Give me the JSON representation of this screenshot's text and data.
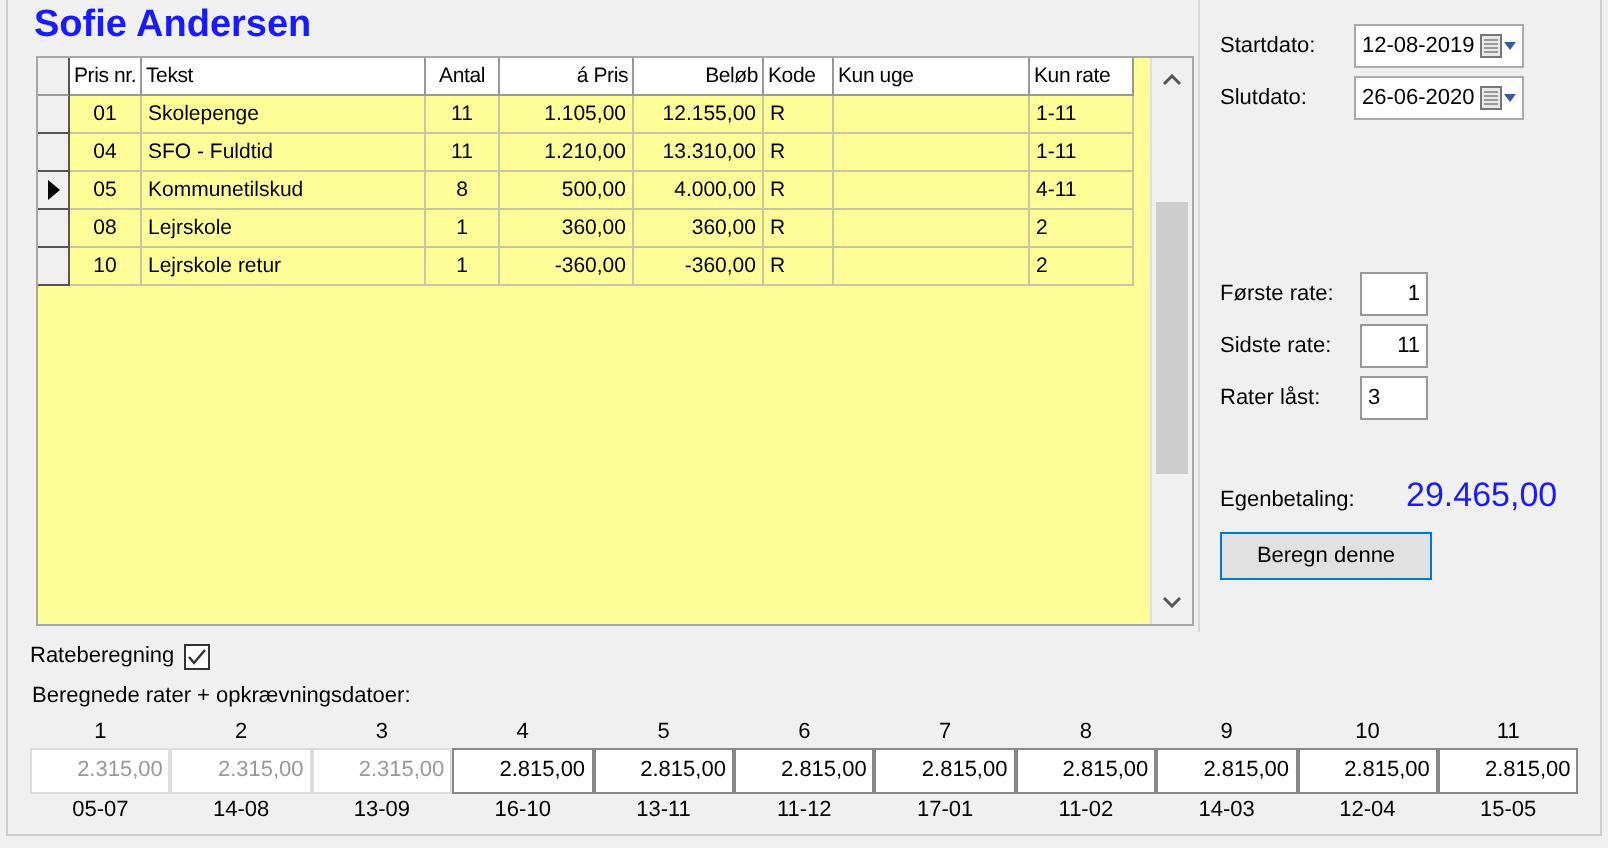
{
  "title": "Sofie Andersen",
  "table": {
    "columns": [
      "Pris nr.",
      "Tekst",
      "Antal",
      "á Pris",
      "Beløb",
      "Kode",
      "Kun uge",
      "Kun rate"
    ],
    "rows": [
      {
        "selected": false,
        "cells": [
          "01",
          "Skolepenge",
          "11",
          "1.105,00",
          "12.155,00",
          "R",
          "",
          "1-11"
        ]
      },
      {
        "selected": false,
        "cells": [
          "04",
          "SFO - Fuldtid",
          "11",
          "1.210,00",
          "13.310,00",
          "R",
          "",
          "1-11"
        ]
      },
      {
        "selected": true,
        "cells": [
          "05",
          "Kommunetilskud",
          "8",
          "500,00",
          "4.000,00",
          "R",
          "",
          "4-11"
        ]
      },
      {
        "selected": false,
        "cells": [
          "08",
          "Lejrskole",
          "1",
          "360,00",
          "360,00",
          "R",
          "",
          "2"
        ]
      },
      {
        "selected": false,
        "cells": [
          "10",
          "Lejrskole retur",
          "1",
          "-360,00",
          "-360,00",
          "R",
          "",
          "2"
        ]
      }
    ]
  },
  "dates": [
    {
      "label": "Startdato:",
      "value": "12-08-2019"
    },
    {
      "label": "Slutdato:",
      "value": "26-06-2020"
    }
  ],
  "rate_fields": [
    {
      "label": "Første rate:",
      "value": "1",
      "kind": "rate"
    },
    {
      "label": "Sidste rate:",
      "value": "11",
      "kind": "rate"
    },
    {
      "label": "Rater låst:",
      "value": "3",
      "kind": "count"
    }
  ],
  "egenbetaling": {
    "label": "Egenbetaling:",
    "value": "29.465,00"
  },
  "button": "Beregn denne",
  "rateberegning": {
    "label": "Rateberegning",
    "checked": true
  },
  "rates_label": "Beregnede rater + opkrævningsdatoer:",
  "rates": [
    {
      "number": "1",
      "amount": "2.315,00",
      "date": "05-07",
      "locked": true
    },
    {
      "number": "2",
      "amount": "2.315,00",
      "date": "14-08",
      "locked": true
    },
    {
      "number": "3",
      "amount": "2.315,00",
      "date": "13-09",
      "locked": true
    },
    {
      "number": "4",
      "amount": "2.815,00",
      "date": "16-10",
      "locked": false
    },
    {
      "number": "5",
      "amount": "2.815,00",
      "date": "13-11",
      "locked": false
    },
    {
      "number": "6",
      "amount": "2.815,00",
      "date": "11-12",
      "locked": false
    },
    {
      "number": "7",
      "amount": "2.815,00",
      "date": "17-01",
      "locked": false
    },
    {
      "number": "8",
      "amount": "2.815,00",
      "date": "11-02",
      "locked": false
    },
    {
      "number": "9",
      "amount": "2.815,00",
      "date": "14-03",
      "locked": false
    },
    {
      "number": "10",
      "amount": "2.815,00",
      "date": "12-04",
      "locked": false
    },
    {
      "number": "11",
      "amount": "2.815,00",
      "date": "15-05",
      "locked": false
    }
  ]
}
